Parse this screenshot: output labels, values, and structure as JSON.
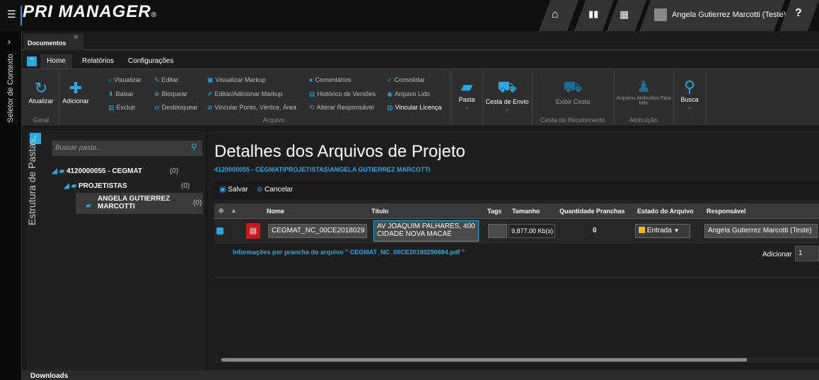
{
  "app": {
    "brand": "PRI MANAGER",
    "brand_mark": "®"
  },
  "topbar": {
    "user_name": "Angela Gutierrez Marcotti (Teste)",
    "help": "?",
    "icons": [
      "home-icon",
      "chart-icon",
      "calendar-icon",
      "user-icon"
    ]
  },
  "sidebar": {
    "label": "Seletor de Contexto",
    "toggle": "›"
  },
  "tabs": {
    "document_tab": "Documentos",
    "close": "×"
  },
  "ribbon_tabs": [
    "Home",
    "Relatórios",
    "Configurações"
  ],
  "ribbon": {
    "atualizar": "Atualizar",
    "geral": "Geral",
    "adicionar": "Adicionar",
    "visualizar": "Visualizar",
    "editar": "Editar",
    "baixar": "Baixar",
    "bloquear": "Bloquear",
    "excluir": "Excluir",
    "desbloquear": "Desbloquear",
    "visualizar_markup": "Visualizar Markup",
    "editar_markup": "Editar/Adicionar Markup",
    "vincular_ponto": "Vincular Ponto, Vértice, Área",
    "comentarios": "Comentários",
    "historico": "Histórico de Versões",
    "alterar_resp": "Alterar Responsável",
    "consolidar": "Consolidar",
    "arquivo_lido": "Arquivo Lido",
    "vincular_licenca": "Vincular Licença",
    "arquivo_group": "Arquivo",
    "pasta": "Pasta",
    "cesta_envio": "Cesta de Envio",
    "exibir_cesta": "Exibir Cesta",
    "cesta_recebimento": "Cesta de Recebimento",
    "arquivos_atribuidos": "Arquivos Atribuídos Para Mim",
    "atribuicao": "Atribuição",
    "busca": "Busca"
  },
  "folders": {
    "panel_label": "Estrutura de Pastas",
    "search_placeholder": "Buscar pasta...",
    "items": [
      {
        "label": "4120000055 - CEGMAT",
        "count": "(0)"
      },
      {
        "label": "PROJETISTAS",
        "count": "(0)"
      },
      {
        "label": "ANGELA GUTIERREZ MARCOTTI",
        "count": "(0)"
      }
    ]
  },
  "main": {
    "title": "Detalhes dos Arquivos de Projeto",
    "path": "4120000055 - CEGMAT\\PROJETISTAS\\ANGELA GUTIERREZ MARCOTTI",
    "save": "Salvar",
    "cancel": "Cancelar"
  },
  "grid": {
    "headers": [
      "Nome",
      "Título",
      "Tags",
      "Tamanho",
      "Quantidade Pranchas",
      "Estado do Arquivo",
      "Responsável"
    ],
    "row": {
      "nome": "CEGMAT_NC_00CE2018029",
      "titulo": "AV JOAQUIM PALHARES, 400 CIDADE NOVA MACAÉ",
      "tags": "",
      "tamanho": "9,877.00 Kb(s)",
      "pranchas": "0",
      "estado": "Entrada",
      "responsavel": "Angela Gutierrez Marcotti (Teste)"
    },
    "info": "Informações por prancha do arquivo \" CEGMAT_NC_00CE20180290694.pdf \"",
    "add_label": "Adicionar",
    "add_value": "1"
  },
  "downloads": "Downloads"
}
